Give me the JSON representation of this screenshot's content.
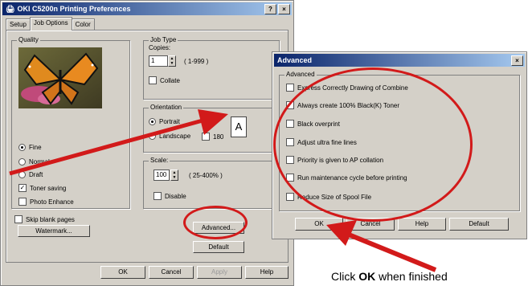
{
  "main_dialog": {
    "title": "OKI C5200n Printing Preferences",
    "help_btn": "?",
    "close_btn": "×",
    "tabs": [
      "Setup",
      "Job Options",
      "Color"
    ],
    "quality": {
      "legend": "Quality",
      "options": [
        "Fine",
        "Normal",
        "Draft"
      ],
      "toner_saving": "Toner saving",
      "photo_enhance": "Photo Enhance"
    },
    "job_type": {
      "legend": "Job Type",
      "copies_label": "Copies:",
      "copies_value": "1",
      "copies_range": "( 1-999 )",
      "collate": "Collate"
    },
    "orientation": {
      "legend": "Orientation",
      "portrait": "Portrait",
      "landscape": "Landscape",
      "rotate": "180"
    },
    "scale": {
      "legend": "Scale:",
      "value": "100",
      "range": "( 25-400% )",
      "disable": "Disable"
    },
    "skip_blank": "Skip blank pages",
    "watermark_btn": "Watermark...",
    "advanced_btn": "Advanced...",
    "default_btn": "Default",
    "ok_btn": "OK",
    "cancel_btn": "Cancel",
    "apply_btn": "Apply",
    "help_footer_btn": "Help"
  },
  "advanced_dialog": {
    "title": "Advanced",
    "close_btn": "×",
    "group_legend": "Advanced",
    "options": [
      "Express Correctly Drawing of Combine",
      "Always create 100% Black(K) Toner",
      "Black overprint",
      "Adjust ultra fine lines",
      "Priority is given to AP collation",
      "Run maintenance cycle before printing",
      "Reduce Size of Spool File"
    ],
    "ok_btn": "OK",
    "cancel_btn": "Cancel",
    "help_btn": "Help",
    "default_btn": "Default"
  },
  "annotation": {
    "caption_prefix": "Click ",
    "caption_bold": "OK",
    "caption_suffix": " when finished",
    "color": "#d21a1a"
  }
}
